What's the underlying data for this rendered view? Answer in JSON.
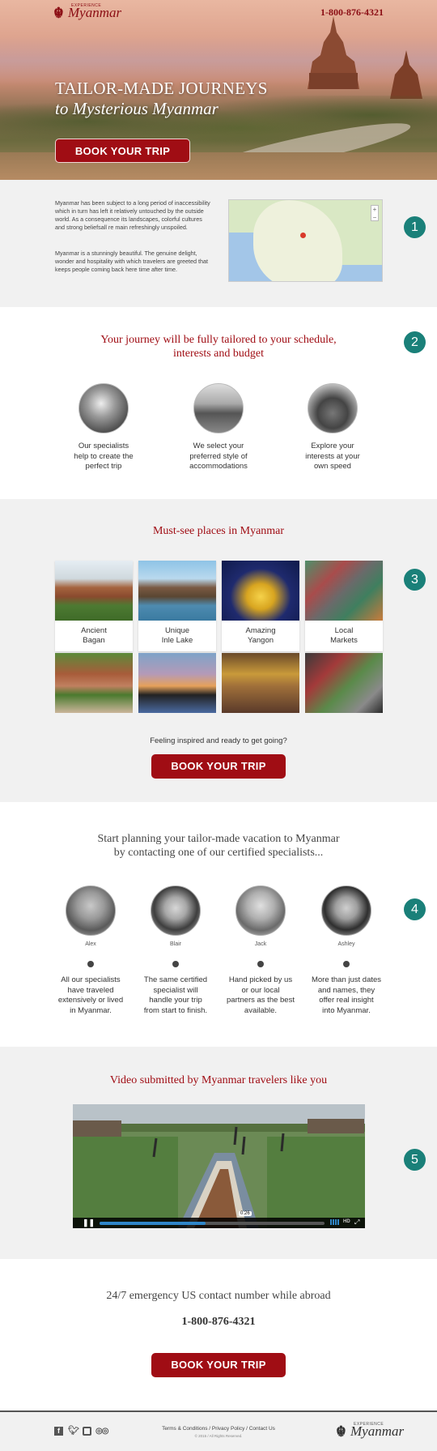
{
  "header": {
    "logo_small": "EXPERIENCE",
    "logo_text": "Myanmar",
    "phone": "1-800-876-4321"
  },
  "hero": {
    "title": "TAILOR-MADE JOURNEYS",
    "subtitle": "to Mysterious Myanmar",
    "cta": "BOOK YOUR TRIP"
  },
  "intro": {
    "number": "1",
    "paragraph1": "Myanmar has been subject to a long period of inaccessibility which in turn has left it relatively untouched by the outside world. As a consequence its landscapes, colorful cultures and strong beliefsall re main refreshingly unspoiled.",
    "paragraph2": "Myanmar is a stunningly beautiful. The genuine delight, wonder and hospitality with which travelers are greeted that keeps people coming back here time after time."
  },
  "tailored": {
    "number": "2",
    "heading_line1": "Your journey will be fully tailored to your schedule,",
    "heading_line2": "interests and budget",
    "features": [
      {
        "line1": "Our specialists",
        "line2": "help to create the",
        "line3": "perfect trip"
      },
      {
        "line1": "We select your",
        "line2": "preferred style of",
        "line3": "accommodations"
      },
      {
        "line1": "Explore your",
        "line2": "interests at your",
        "line3": "own speed"
      }
    ]
  },
  "places": {
    "number": "3",
    "heading": "Must-see places in Myanmar",
    "items": [
      {
        "line1": "Ancient",
        "line2": "Bagan"
      },
      {
        "line1": "Unique",
        "line2": "Inle Lake"
      },
      {
        "line1": "Amazing",
        "line2": "Yangon"
      },
      {
        "line1": "Local",
        "line2": "Markets"
      }
    ],
    "prompt": "Feeling inspired and ready to get going?",
    "cta": "BOOK YOUR TRIP"
  },
  "specialists": {
    "number": "4",
    "heading_line1": "Start planning your tailor-made vacation to Myanmar",
    "heading_line2": "by contacting one of our certified specialists...",
    "people": [
      {
        "name": "Alex",
        "line1": "All our specialists",
        "line2": "have traveled",
        "line3": "extensively or lived",
        "line4": "in Myanmar."
      },
      {
        "name": "Blair",
        "line1": "The same certified",
        "line2": "specialist will",
        "line3": "handle your trip",
        "line4": "from start to finish."
      },
      {
        "name": "Jack",
        "line1": "Hand picked by us",
        "line2": "or our local",
        "line3": "partners as the best",
        "line4": "available."
      },
      {
        "name": "Ashley",
        "line1": "More than just dates",
        "line2": "and names, they",
        "line3": "offer real insight",
        "line4": "into Myanmar."
      }
    ]
  },
  "video": {
    "number": "5",
    "heading": "Video submitted by Myanmar travelers like you",
    "time": "0:26",
    "hd": "HD",
    "progress": 0.47
  },
  "contact": {
    "heading": "24/7 emergency US contact number while abroad",
    "phone": "1-800-876-4321",
    "cta": "BOOK YOUR TRIP"
  },
  "footer": {
    "links": "Terms & Conditions / Privacy Policy / Contact Us",
    "copyright": "© 2015 / All Rights Reserved.",
    "social_icons": [
      "facebook-icon",
      "twitter-icon",
      "instagram-icon",
      "tripadvisor-icon"
    ],
    "logo_small": "EXPERIENCE",
    "logo_text": "Myanmar"
  },
  "colors": {
    "brand_red": "#a00d14",
    "badge_teal": "#1a8079",
    "section_gray": "#f1f1f1"
  }
}
